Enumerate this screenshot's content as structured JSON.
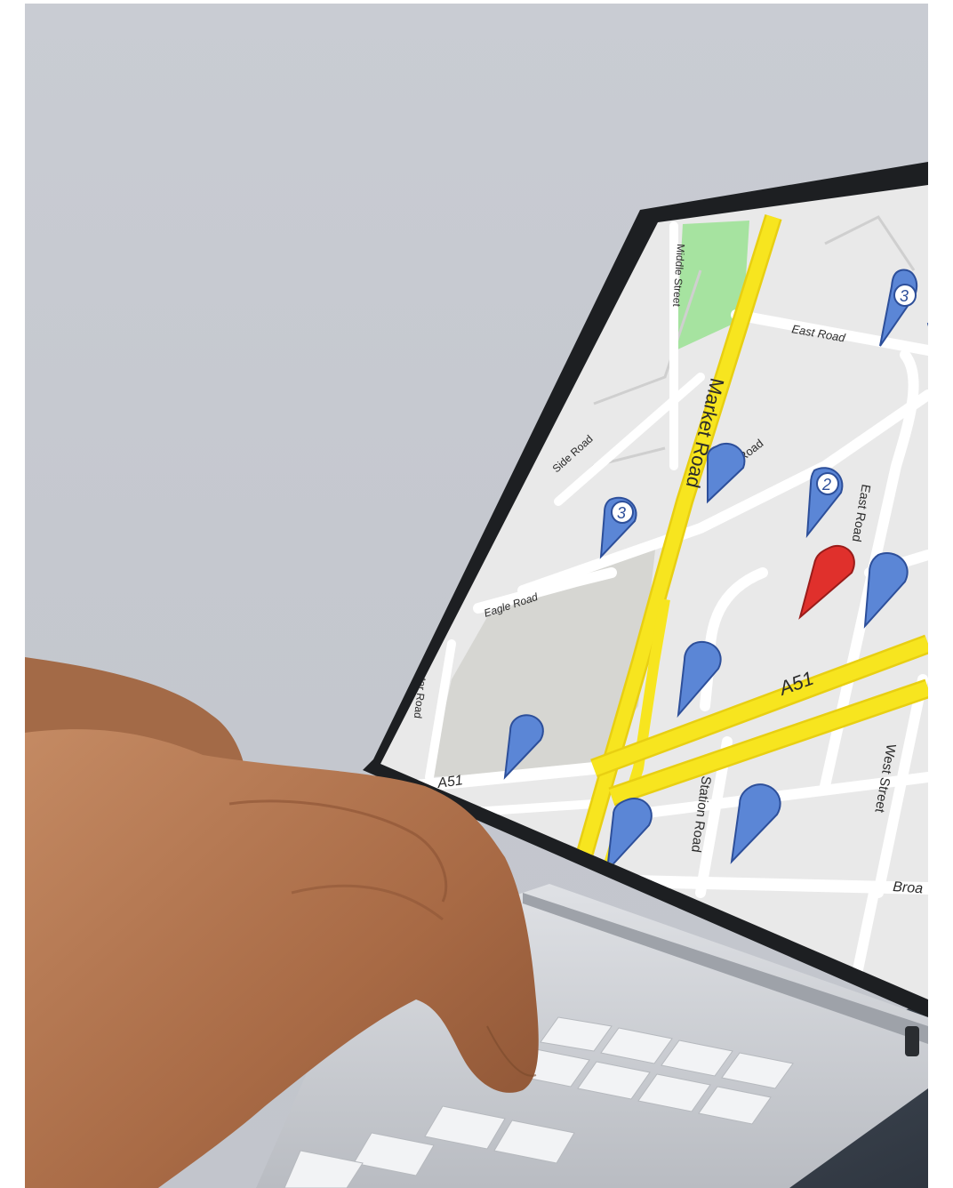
{
  "scene": {
    "kind": "photo-laptop-map",
    "background_color": "#c6c9d0"
  },
  "map": {
    "road_labels": {
      "middle_street": "Middle Street",
      "east_road_top": "East Road",
      "market_road": "Market Road",
      "eagle_road_upper": "Eagle Road",
      "side_road": "Side Road",
      "eagle_road_lower": "Eagle Road",
      "perimeter_road": "Perimeter Road",
      "east_road_vertical": "East Road",
      "a51_right": "A51",
      "a51_left": "A51",
      "station_road": "Station Road",
      "west_street": "West Street",
      "broad_partial": "Broa"
    },
    "pins": [
      {
        "label": "3",
        "color": "#5b86d6"
      },
      {
        "label": "2",
        "color": "#5b86d6"
      },
      {
        "label": "3",
        "color": "#5b86d6"
      },
      {
        "label": "",
        "color": "#e0302c"
      }
    ],
    "colors": {
      "land": "#e9e9e9",
      "road": "#ffffff",
      "highway": "#f7e51f",
      "park": "#a6e3a0",
      "block": "#d6d6d2",
      "pin_blue": "#5b86d6",
      "pin_red": "#e0302c"
    }
  }
}
